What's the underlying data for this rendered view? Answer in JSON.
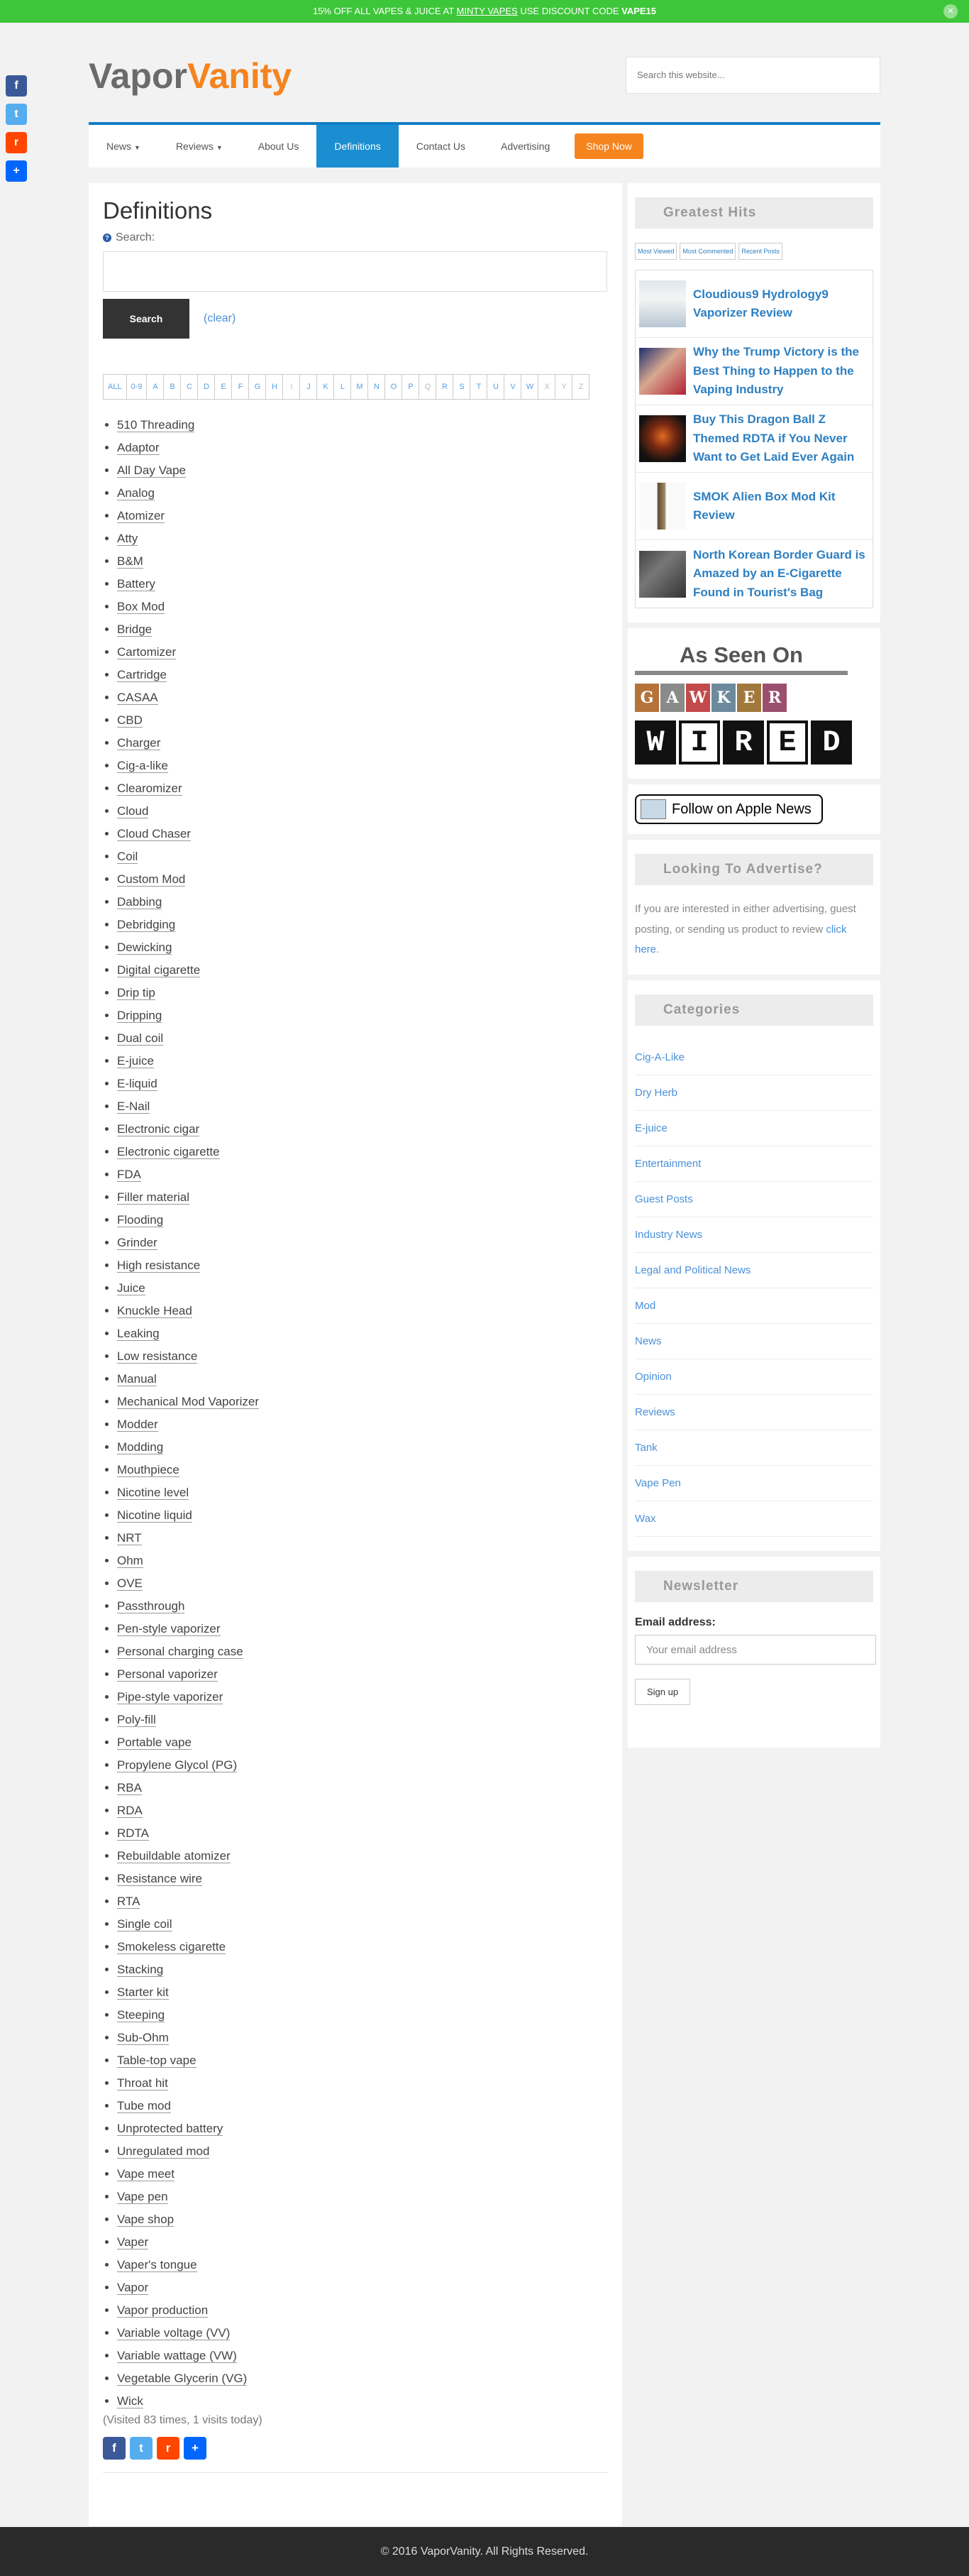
{
  "promo": {
    "pre": "15% OFF ALL VAPES & JUICE AT ",
    "link": "MINTY VAPES",
    "mid": " USE DISCOUNT CODE ",
    "code": "VAPE15",
    "close": "✕"
  },
  "social": {
    "facebook": "f",
    "twitter": "t",
    "reddit": "r",
    "share": "+"
  },
  "brand": {
    "part1": "Vapor",
    "part2": "Vanity"
  },
  "top_search": {
    "placeholder": "Search this website..."
  },
  "nav": {
    "items": [
      {
        "label": "News",
        "caret": "▼"
      },
      {
        "label": "Reviews",
        "caret": "▼"
      },
      {
        "label": "About Us"
      },
      {
        "label": "Definitions"
      },
      {
        "label": "Contact Us"
      },
      {
        "label": "Advertising"
      }
    ],
    "shop": "Shop Now"
  },
  "main": {
    "title": "Definitions",
    "search_label": "Search:",
    "search_button": "Search",
    "clear": "(clear)",
    "letters": [
      "ALL",
      "0-9",
      "A",
      "B",
      "C",
      "D",
      "E",
      "F",
      "G",
      "H",
      "I",
      "J",
      "K",
      "L",
      "M",
      "N",
      "O",
      "P",
      "Q",
      "R",
      "S",
      "T",
      "U",
      "V",
      "W",
      "X",
      "Y",
      "Z"
    ],
    "terms": [
      "510 Threading",
      "Adaptor",
      "All Day Vape",
      "Analog",
      "Atomizer",
      "Atty",
      "B&M",
      "Battery",
      "Box Mod",
      "Bridge",
      "Cartomizer",
      "Cartridge",
      "CASAA",
      "CBD",
      "Charger",
      "Cig-a-like",
      "Clearomizer",
      "Cloud",
      "Cloud Chaser",
      "Coil",
      "Custom Mod",
      "Dabbing",
      "Debridging",
      "Dewicking",
      "Digital cigarette",
      "Drip tip",
      "Dripping",
      "Dual coil",
      "E-juice",
      "E-liquid",
      "E-Nail",
      "Electronic cigar",
      "Electronic cigarette",
      "FDA",
      "Filler material",
      "Flooding",
      "Grinder",
      "High resistance",
      "Juice",
      "Knuckle Head",
      "Leaking",
      "Low resistance",
      "Manual",
      "Mechanical Mod Vaporizer",
      "Modder",
      "Modding",
      "Mouthpiece",
      "Nicotine level",
      "Nicotine liquid",
      "NRT",
      "Ohm",
      "OVE",
      "Passthrough",
      "Pen-style vaporizer",
      "Personal charging case",
      "Personal vaporizer",
      "Pipe-style vaporizer",
      "Poly-fill",
      "Portable vape",
      "Propylene Glycol (PG)",
      "RBA",
      "RDA",
      "RDTA",
      "Rebuildable atomizer",
      "Resistance wire",
      "RTA",
      "Single coil",
      "Smokeless cigarette",
      "Stacking",
      "Starter kit",
      "Steeping",
      "Sub-Ohm",
      "Table-top vape",
      "Throat hit",
      "Tube mod",
      "Unprotected battery",
      "Unregulated mod",
      "Vape meet",
      "Vape pen",
      "Vape shop",
      "Vaper",
      "Vaper's tongue",
      "Vapor",
      "Vapor production",
      "Variable voltage (VV)",
      "Variable wattage (VW)",
      "Vegetable Glycerin (VG)",
      "Wick"
    ],
    "visits": "(Visited 83 times, 1 visits today)"
  },
  "sidebar": {
    "greatest_hits": {
      "title": "Greatest Hits",
      "tabs": [
        "Most Viewed",
        "Most Commented",
        "Recent Posts"
      ],
      "posts": [
        {
          "title": "Cloudious9 Hydrology9 Vaporizer Review"
        },
        {
          "title": "Why the Trump Victory is the Best Thing to Happen to the Vaping Industry"
        },
        {
          "title": "Buy This Dragon Ball Z Themed RDTA if You Never Want to Get Laid Ever Again"
        },
        {
          "title": "SMOK Alien Box Mod Kit Review"
        },
        {
          "title": "North Korean Border Guard is Amazed by an E-Cigarette Found in Tourist's Bag"
        }
      ]
    },
    "as_seen_on": {
      "title": "As Seen On",
      "gawker": [
        "G",
        "A",
        "W",
        "K",
        "E",
        "R"
      ],
      "wired": [
        "W",
        "I",
        "R",
        "E",
        "D"
      ]
    },
    "apple_news": "Follow on Apple News",
    "advertise": {
      "title": "Looking To Advertise?",
      "text": "If you are interested in either advertising, guest posting, or sending us product to review ",
      "link": "click here",
      "end": "."
    },
    "categories": {
      "title": "Categories",
      "items": [
        "Cig-A-Like",
        "Dry Herb",
        "E-juice",
        "Entertainment",
        "Guest Posts",
        "Industry News",
        "Legal and Political News",
        "Mod",
        "News",
        "Opinion",
        "Reviews",
        "Tank",
        "Vape Pen",
        "Wax"
      ]
    },
    "newsletter": {
      "title": "Newsletter",
      "label": "Email address:",
      "placeholder": "Your email address",
      "button": "Sign up"
    }
  },
  "footer": "© 2016 VaporVanity. All Rights Reserved.",
  "colors": {
    "promo": "#3ec63a",
    "accent": "#f5841f",
    "nav_active": "#1a8ed0",
    "link": "#2d7fc1"
  }
}
